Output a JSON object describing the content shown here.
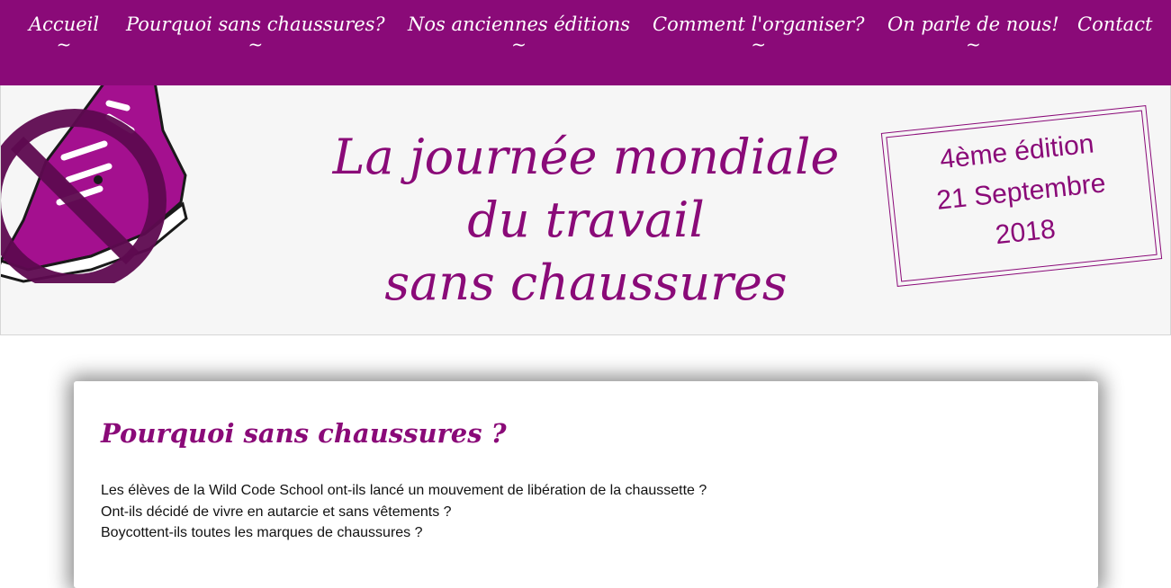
{
  "colors": {
    "brand": "#8a0a78",
    "nav_text": "#ffffff",
    "header_bg": "#f6f6f6"
  },
  "nav": {
    "items": [
      {
        "label": "Accueil",
        "tilde": "~"
      },
      {
        "label": "Pourquoi sans chaussures?",
        "tilde": "~"
      },
      {
        "label": "Nos anciennes éditions",
        "tilde": "~"
      },
      {
        "label": "Comment l'organiser?",
        "tilde": "~"
      },
      {
        "label": "On parle de nous!",
        "tilde": "~"
      },
      {
        "label": "Contact",
        "tilde": ""
      }
    ]
  },
  "header": {
    "logo_icon": "no-sneaker-icon",
    "title_lines": [
      "La journée mondiale",
      "du travail",
      "sans chaussures"
    ],
    "stamp_lines": [
      "4ème édition",
      "21 Septembre",
      "2018"
    ]
  },
  "main": {
    "heading": "Pourquoi sans chaussures ?",
    "paragraph_lines": [
      "Les élèves de la Wild Code School ont-ils lancé un mouvement de libération de la chaussette ?",
      "Ont-ils décidé de vivre en autarcie et sans vêtements ?",
      "Boycottent-ils toutes les marques de chaussures ?"
    ]
  }
}
